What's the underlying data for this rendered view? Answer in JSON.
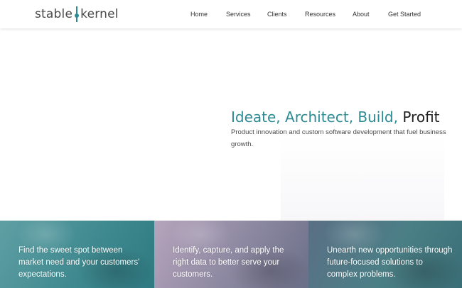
{
  "header": {
    "logo_left": "stable",
    "logo_right": "kernel",
    "nav": [
      {
        "label": "Home"
      },
      {
        "label": "Services"
      },
      {
        "label": "Clients"
      },
      {
        "label": "Resources"
      },
      {
        "label": "About"
      },
      {
        "label": "Get Started"
      }
    ]
  },
  "hero": {
    "title_main": "Ideate, Architect, Build,",
    "title_accent": "Profit",
    "subtitle": "Product innovation and custom software development that fuel business growth."
  },
  "cards": [
    {
      "text": "Find the sweet spot between market need and your customers' expectations."
    },
    {
      "text": "Identify, capture, and apply the right data to better serve your customers."
    },
    {
      "text": "Unearth new opportunities through future-focused solutions to complex problems."
    }
  ],
  "colors": {
    "brand_teal": "#2d8a93",
    "text_dark": "#1d1d1d",
    "nav_text": "#333333"
  }
}
